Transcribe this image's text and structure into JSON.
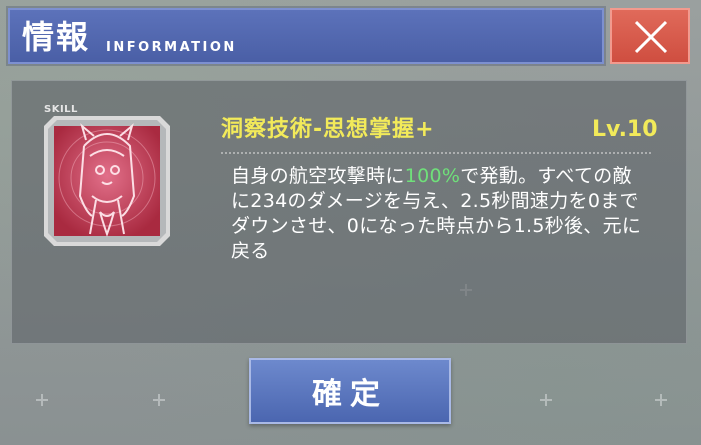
{
  "header": {
    "title_jp": "情報",
    "title_en": "INFORMATION",
    "close_icon": "close-x-icon"
  },
  "skill": {
    "badge": "SKILL",
    "icon": "character-portrait-icon",
    "name": "洞察技術-思想掌握+",
    "level": "Lv.10",
    "description": {
      "before": "自身の航空攻撃時に",
      "highlight": "100%",
      "after": "で発動。すべての敵に234のダメージを与え、2.5秒間速力を0までダウンさせ、0になった時点から1.5秒後、元に戻る"
    }
  },
  "confirm": {
    "label": "確定"
  },
  "colors": {
    "header_blue": "#4a5fa6",
    "close_red": "#cf4e40",
    "skill_name_yellow": "#f2ea5a",
    "highlight_green": "#6fe07a",
    "portrait_red": "#c23d52"
  }
}
